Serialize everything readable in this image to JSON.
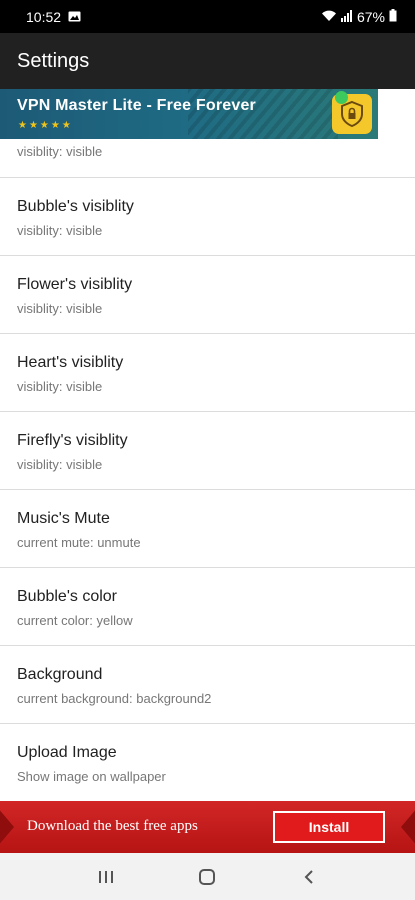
{
  "status_bar": {
    "time": "10:52",
    "battery": "67%",
    "icons": [
      "image-icon",
      "wifi-icon",
      "signal-icon",
      "battery-icon"
    ]
  },
  "app_bar": {
    "title": "Settings"
  },
  "top_ad": {
    "title": "VPN Master Lite - Free Forever",
    "stars": "★★★★★",
    "colors": {
      "background": "#1f6b84",
      "logo": "#f4c72a"
    }
  },
  "settings": {
    "partial_subtitle": "visiblity: visible",
    "items": [
      {
        "title": "Bubble's visiblity",
        "subtitle": "visiblity: visible"
      },
      {
        "title": "Flower's visiblity",
        "subtitle": "visiblity: visible"
      },
      {
        "title": "Heart's visiblity",
        "subtitle": "visiblity: visible"
      },
      {
        "title": "Firefly's visiblity",
        "subtitle": "visiblity: visible"
      },
      {
        "title": "Music's Mute",
        "subtitle": "current mute: unmute"
      },
      {
        "title": "Bubble's color",
        "subtitle": "current color: yellow"
      },
      {
        "title": "Background",
        "subtitle": "current background: background2"
      },
      {
        "title": "Upload Image",
        "subtitle": "Show image on wallpaper"
      }
    ]
  },
  "bottom_ad": {
    "text": "Download the best free apps",
    "button_label": "Install",
    "colors": {
      "background": "#c81d1d"
    }
  },
  "nav_bar": {
    "icons": [
      "recents-icon",
      "home-icon",
      "back-icon"
    ]
  }
}
